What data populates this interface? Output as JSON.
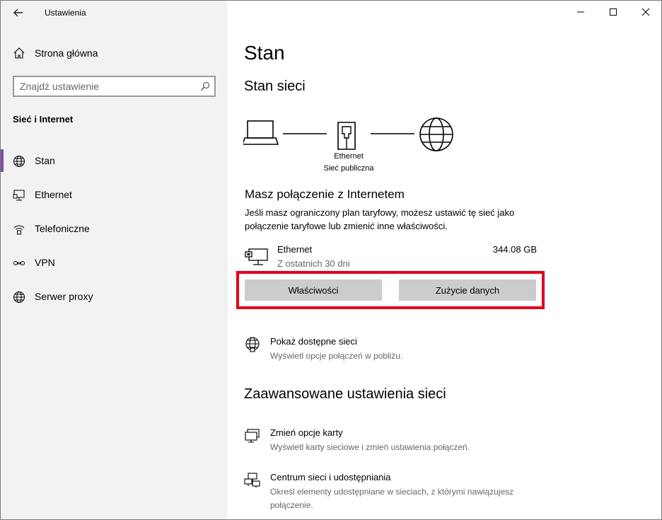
{
  "window": {
    "title": "Ustawienia",
    "back_icon": "arrow-left-icon",
    "minimize_icon": "minimize-icon",
    "maximize_icon": "maximize-icon",
    "close_icon": "close-icon"
  },
  "sidebar": {
    "home_label": "Strona główna",
    "search_placeholder": "Znajdź ustawienie",
    "section_title": "Sieć i Internet",
    "active_color": "#7b4fa0",
    "items": [
      {
        "label": "Stan",
        "icon": "globe-icon",
        "active": true
      },
      {
        "label": "Ethernet",
        "icon": "ethernet-icon",
        "active": false
      },
      {
        "label": "Telefoniczne",
        "icon": "dialup-icon",
        "active": false
      },
      {
        "label": "VPN",
        "icon": "vpn-icon",
        "active": false
      },
      {
        "label": "Serwer proxy",
        "icon": "globe-icon",
        "active": false
      }
    ]
  },
  "main": {
    "page_title": "Stan",
    "network_status_title": "Stan sieci",
    "diagram": {
      "adapter_name": "Ethernet",
      "network_type": "Sieć publiczna"
    },
    "connection_title": "Masz połączenie z Internetem",
    "connection_desc": "Jeśli masz ograniczony plan taryfowy, możesz ustawić tę sieć jako połączenie taryfowe lub zmienić inne właściwości.",
    "adapter": {
      "name": "Ethernet",
      "period": "Z ostatnich 30 dni",
      "usage": "344.08 GB"
    },
    "buttons": {
      "properties": "Właściwości",
      "data_usage": "Zużycie danych"
    },
    "highlight_color": "#e3001b",
    "show_networks": {
      "title": "Pokaż dostępne sieci",
      "desc": "Wyświetl opcje połączeń w pobliżu."
    },
    "advanced_title": "Zaawansowane ustawienia sieci",
    "advanced": [
      {
        "title": "Zmień opcje karty",
        "desc": "Wyświetl karty sieciowe i zmień ustawienia połączeń.",
        "icon": "adapter-icon"
      },
      {
        "title": "Centrum sieci i udostępniania",
        "desc": "Określ elementy udostępniane w sieciach, z którymi nawiązujesz połączenie.",
        "icon": "sharing-center-icon"
      }
    ]
  }
}
